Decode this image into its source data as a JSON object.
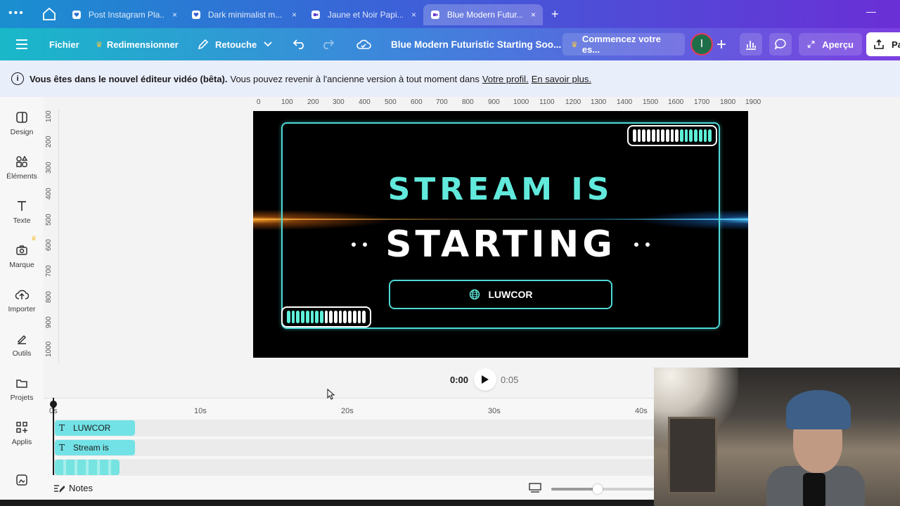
{
  "browser": {
    "tabs": [
      {
        "label": "Post Instagram Pla...",
        "icon": "canva-heart-icon",
        "active": false
      },
      {
        "label": "Dark minimalist m...",
        "icon": "canva-heart-icon",
        "active": false
      },
      {
        "label": "Jaune et Noir Papi...",
        "icon": "video-icon",
        "active": false
      },
      {
        "label": "Blue Modern Futur...",
        "icon": "video-icon",
        "active": true
      }
    ],
    "close_glyph": "×",
    "new_tab_glyph": "+",
    "minimize_glyph": "—"
  },
  "toolbar": {
    "file": "Fichier",
    "resize": "Redimensionner",
    "retouch": "Retouche",
    "doc_title": "Blue Modern Futuristic Starting Soo...",
    "trial": "Commencez votre es...",
    "avatar_initial": "I",
    "preview": "Aperçu",
    "share": "Pa"
  },
  "banner": {
    "bold": "Vous êtes dans le nouvel éditeur vidéo (bêta).",
    "text": "Vous pouvez revenir à l'ancienne version à tout moment dans",
    "link_profile": "Votre profil.",
    "link_more": "En savoir plus."
  },
  "sidebar": {
    "items": [
      {
        "label": "Design",
        "icon": "design-icon"
      },
      {
        "label": "Éléments",
        "icon": "elements-icon"
      },
      {
        "label": "Texte",
        "icon": "text-icon"
      },
      {
        "label": "Marque",
        "icon": "brand-icon"
      },
      {
        "label": "Importer",
        "icon": "upload-icon"
      },
      {
        "label": "Outils",
        "icon": "tools-icon"
      },
      {
        "label": "Projets",
        "icon": "folder-icon"
      },
      {
        "label": "Applis",
        "icon": "apps-icon"
      }
    ]
  },
  "ruler": {
    "top": [
      "0",
      "100",
      "200",
      "300",
      "400",
      "500",
      "600",
      "700",
      "800",
      "900",
      "1000",
      "1100",
      "1200",
      "1300",
      "1400",
      "1500",
      "1600",
      "1700",
      "1800",
      "1900"
    ],
    "left": [
      "100",
      "200",
      "300",
      "400",
      "500",
      "600",
      "700",
      "800",
      "900",
      "1000"
    ]
  },
  "canvas": {
    "line1": "STREAM IS",
    "line2": "STARTING",
    "cta": "LUWCOR",
    "accent": "#61e9dc",
    "background": "#000000"
  },
  "playback": {
    "current": "0:00",
    "total": "0:05"
  },
  "timeline": {
    "marks": [
      "0s",
      "10s",
      "20s",
      "30s",
      "40s"
    ],
    "tracks": [
      {
        "label": "LUWCOR",
        "type": "text"
      },
      {
        "label": "Stream is",
        "type": "text"
      },
      {
        "label": "",
        "type": "media"
      }
    ]
  },
  "bottom": {
    "notes": "Notes",
    "zoom_fraction": 0.45
  }
}
